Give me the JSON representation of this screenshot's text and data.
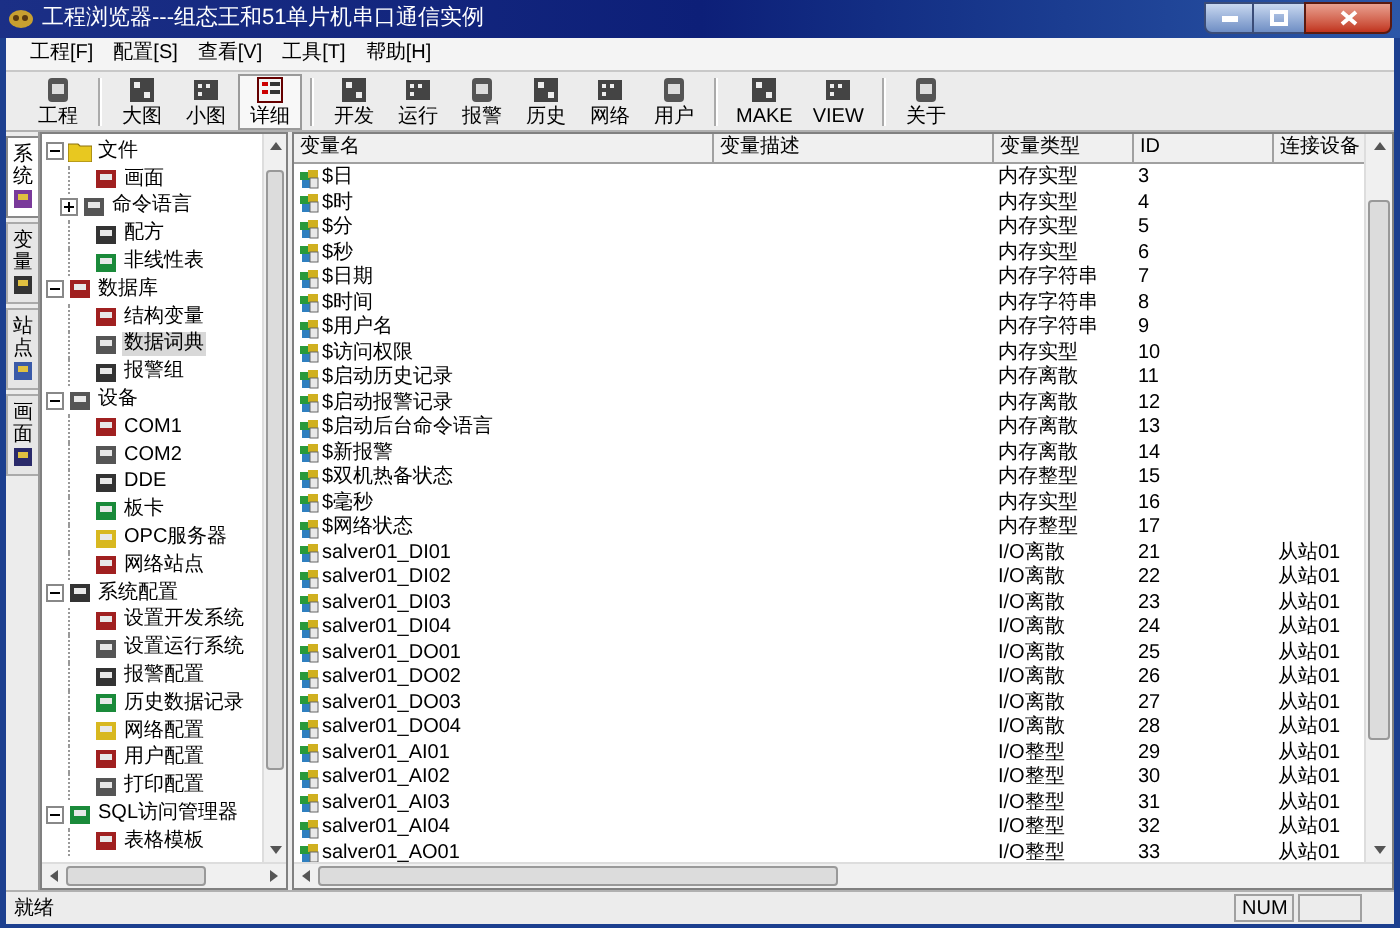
{
  "window": {
    "title": "工程浏览器---组态王和51单片机串口通信实例"
  },
  "menu": [
    "工程[F]",
    "配置[S]",
    "查看[V]",
    "工具[T]",
    "帮助[H]"
  ],
  "toolbar": [
    {
      "label": "工程",
      "selected": false
    },
    {
      "label": "大图",
      "selected": false
    },
    {
      "label": "小图",
      "selected": false
    },
    {
      "label": "详细",
      "selected": true
    },
    {
      "label": "开发",
      "selected": false
    },
    {
      "label": "运行",
      "selected": false
    },
    {
      "label": "报警",
      "selected": false
    },
    {
      "label": "历史",
      "selected": false
    },
    {
      "label": "网络",
      "selected": false
    },
    {
      "label": "用户",
      "selected": false
    },
    {
      "label": "MAKE",
      "selected": false
    },
    {
      "label": "VIEW",
      "selected": false
    },
    {
      "label": "关于",
      "selected": false
    }
  ],
  "side_tabs": [
    {
      "label": "系统",
      "selected": true
    },
    {
      "label": "变量",
      "selected": false
    },
    {
      "label": "站点",
      "selected": false
    },
    {
      "label": "画面",
      "selected": false
    }
  ],
  "tree": [
    {
      "label": "文件",
      "expanded": true,
      "selected": false,
      "children": [
        {
          "label": "画面",
          "selected": false
        },
        {
          "label": "命令语言",
          "expanded": false,
          "selected": false
        },
        {
          "label": "配方",
          "selected": false
        },
        {
          "label": "非线性表",
          "selected": false
        }
      ]
    },
    {
      "label": "数据库",
      "expanded": true,
      "selected": false,
      "children": [
        {
          "label": "结构变量",
          "selected": false
        },
        {
          "label": "数据词典",
          "selected": true
        },
        {
          "label": "报警组",
          "selected": false
        }
      ]
    },
    {
      "label": "设备",
      "expanded": true,
      "selected": false,
      "children": [
        {
          "label": "COM1",
          "selected": false
        },
        {
          "label": "COM2",
          "selected": false
        },
        {
          "label": "DDE",
          "selected": false
        },
        {
          "label": "板卡",
          "selected": false
        },
        {
          "label": "OPC服务器",
          "selected": false
        },
        {
          "label": "网络站点",
          "selected": false
        }
      ]
    },
    {
      "label": "系统配置",
      "expanded": true,
      "selected": false,
      "children": [
        {
          "label": "设置开发系统",
          "selected": false
        },
        {
          "label": "设置运行系统",
          "selected": false
        },
        {
          "label": "报警配置",
          "selected": false
        },
        {
          "label": "历史数据记录",
          "selected": false
        },
        {
          "label": "网络配置",
          "selected": false
        },
        {
          "label": "用户配置",
          "selected": false
        },
        {
          "label": "打印配置",
          "selected": false
        }
      ]
    },
    {
      "label": "SQL访问管理器",
      "expanded": true,
      "selected": false,
      "children": [
        {
          "label": "表格模板",
          "selected": false
        }
      ]
    }
  ],
  "table": {
    "columns": [
      "变量名",
      "变量描述",
      "变量类型",
      "ID",
      "连接设备"
    ],
    "rows": [
      [
        "$日",
        "",
        "内存实型",
        "3",
        ""
      ],
      [
        "$时",
        "",
        "内存实型",
        "4",
        ""
      ],
      [
        "$分",
        "",
        "内存实型",
        "5",
        ""
      ],
      [
        "$秒",
        "",
        "内存实型",
        "6",
        ""
      ],
      [
        "$日期",
        "",
        "内存字符串",
        "7",
        ""
      ],
      [
        "$时间",
        "",
        "内存字符串",
        "8",
        ""
      ],
      [
        "$用户名",
        "",
        "内存字符串",
        "9",
        ""
      ],
      [
        "$访问权限",
        "",
        "内存实型",
        "10",
        ""
      ],
      [
        "$启动历史记录",
        "",
        "内存离散",
        "11",
        ""
      ],
      [
        "$启动报警记录",
        "",
        "内存离散",
        "12",
        ""
      ],
      [
        "$启动后台命令语言",
        "",
        "内存离散",
        "13",
        ""
      ],
      [
        "$新报警",
        "",
        "内存离散",
        "14",
        ""
      ],
      [
        "$双机热备状态",
        "",
        "内存整型",
        "15",
        ""
      ],
      [
        "$毫秒",
        "",
        "内存实型",
        "16",
        ""
      ],
      [
        "$网络状态",
        "",
        "内存整型",
        "17",
        ""
      ],
      [
        "salver01_DI01",
        "",
        "I/O离散",
        "21",
        "从站01"
      ],
      [
        "salver01_DI02",
        "",
        "I/O离散",
        "22",
        "从站01"
      ],
      [
        "salver01_DI03",
        "",
        "I/O离散",
        "23",
        "从站01"
      ],
      [
        "salver01_DI04",
        "",
        "I/O离散",
        "24",
        "从站01"
      ],
      [
        "salver01_DO01",
        "",
        "I/O离散",
        "25",
        "从站01"
      ],
      [
        "salver01_DO02",
        "",
        "I/O离散",
        "26",
        "从站01"
      ],
      [
        "salver01_DO03",
        "",
        "I/O离散",
        "27",
        "从站01"
      ],
      [
        "salver01_DO04",
        "",
        "I/O离散",
        "28",
        "从站01"
      ],
      [
        "salver01_AI01",
        "",
        "I/O整型",
        "29",
        "从站01"
      ],
      [
        "salver01_AI02",
        "",
        "I/O整型",
        "30",
        "从站01"
      ],
      [
        "salver01_AI03",
        "",
        "I/O整型",
        "31",
        "从站01"
      ],
      [
        "salver01_AI04",
        "",
        "I/O整型",
        "32",
        "从站01"
      ],
      [
        "salver01_AO01",
        "",
        "I/O整型",
        "33",
        "从站01"
      ]
    ]
  },
  "status_bar": {
    "message": "就绪",
    "indicator": "NUM"
  }
}
